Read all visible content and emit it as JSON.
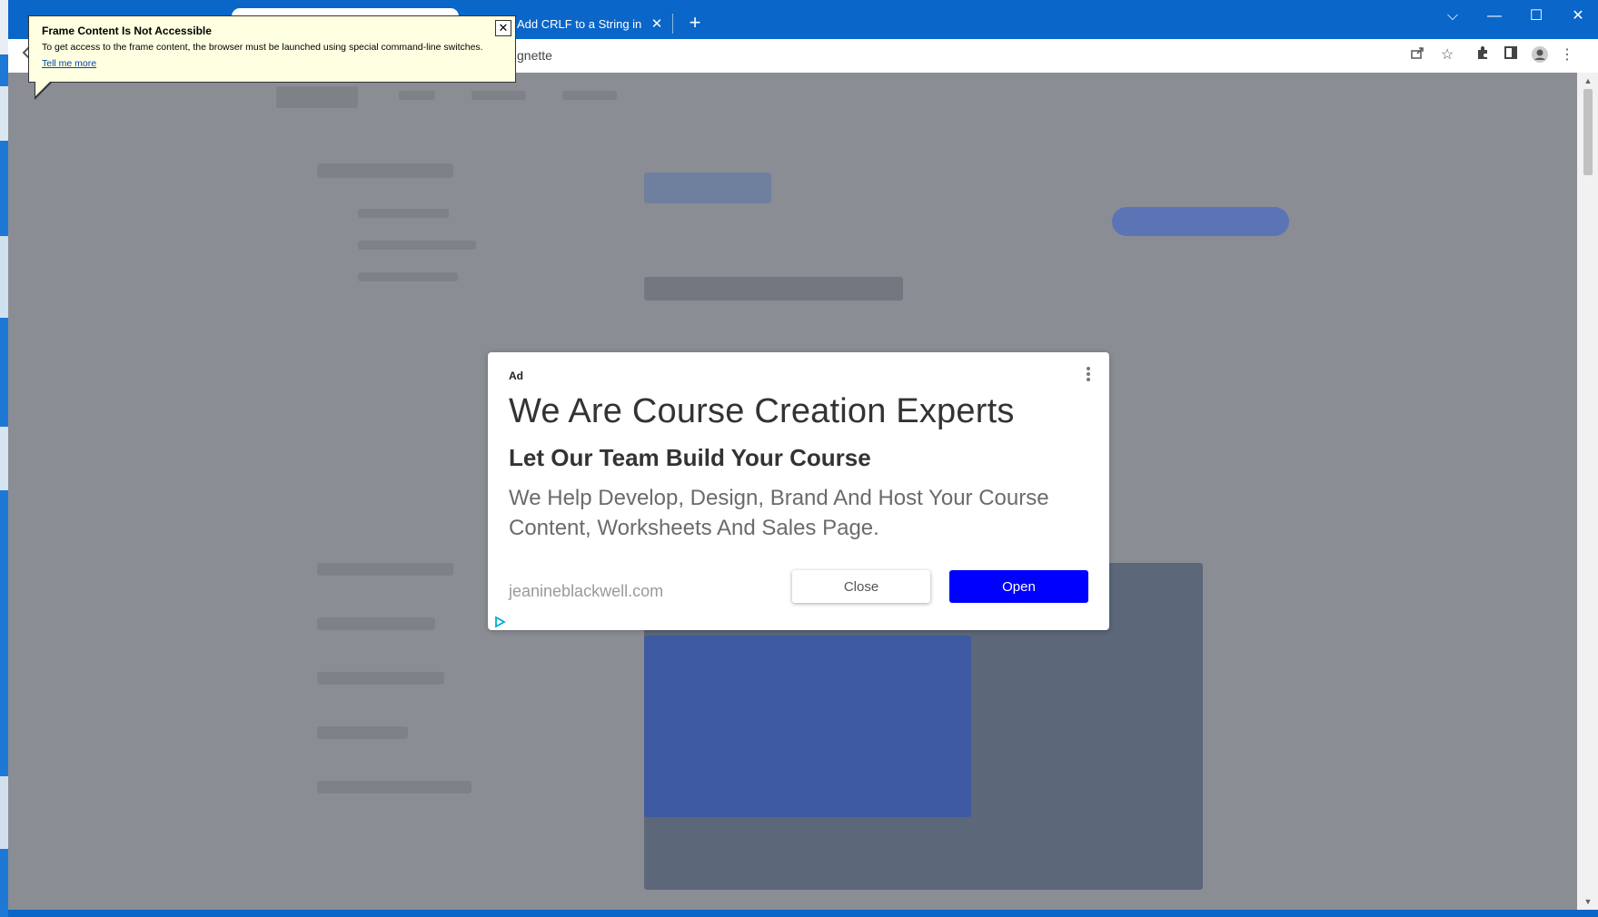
{
  "colors": {
    "accent_blue": "#0a66c8",
    "ad_open_button": "#0000ff",
    "balloon_bg": "#ffffe1",
    "page_overlay": "#8b8d94"
  },
  "browser": {
    "tab": {
      "label": "Add CRLF to a String in P",
      "close_icon": "close-icon"
    },
    "new_tab_label": "+",
    "address_text": "gnette",
    "window_controls": {
      "dropdown": "⌵",
      "minimize": "—",
      "maximize": "☐",
      "close": "✕"
    }
  },
  "balloon": {
    "title": "Frame Content Is Not Accessible",
    "text": "To get access to the frame content, the browser must be launched using special command-line switches.",
    "link": "Tell me more",
    "close": "✕"
  },
  "ad": {
    "label": "Ad",
    "headline": "We Are Course Creation Experts",
    "subheadline": "Let Our Team Build Your Course",
    "body": "We Help Develop, Design, Brand And Host Your Course Content, Worksheets And Sales Page.",
    "domain": "jeanineblackwell.com",
    "close_button": "Close",
    "open_button": "Open"
  }
}
